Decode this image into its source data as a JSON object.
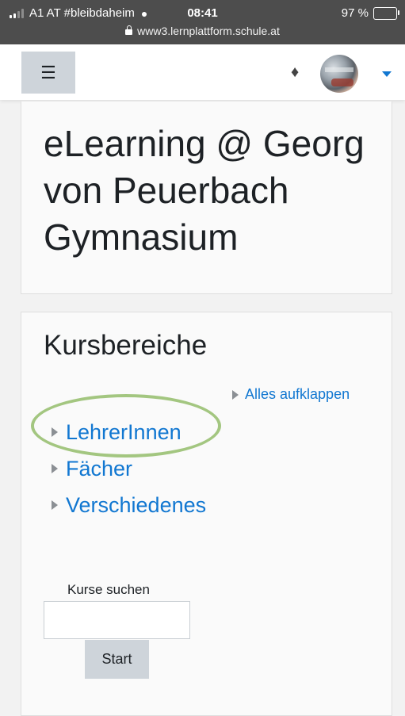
{
  "status_bar": {
    "carrier": "A1 AT #bleibdaheim",
    "time": "08:41",
    "battery": "97 %",
    "url": "www3.lernplattform.schule.at"
  },
  "navbar": {
    "menu_icon": "hamburger-icon",
    "notification_icon": "bell-icon",
    "user_menu_icon": "chevron-down-icon"
  },
  "site": {
    "title": "eLearning @ Georg von Peuerbach Gymnasium"
  },
  "course_categories": {
    "heading": "Kursbereiche",
    "expand_all": "Alles aufklappen",
    "items": [
      {
        "label": "LehrerInnen"
      },
      {
        "label": "Fächer"
      },
      {
        "label": "Verschiedenes"
      }
    ]
  },
  "course_search": {
    "label": "Kurse suchen",
    "value": "",
    "button": "Start"
  },
  "colors": {
    "link": "#1177d1",
    "highlight_ring": "#a3c680",
    "status_bar_bg": "#4d4d4d"
  }
}
